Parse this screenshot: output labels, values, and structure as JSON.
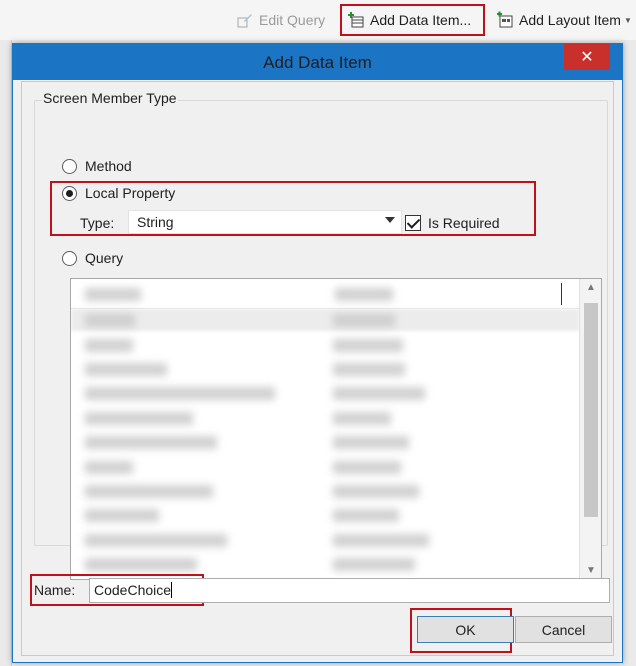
{
  "toolbar": {
    "edit_query": "Edit Query",
    "add_data_item": "Add Data Item...",
    "add_layout_item": "Add Layout Item"
  },
  "dialog": {
    "title": "Add Data Item",
    "close_glyph": "✕",
    "group_label": "Screen Member Type",
    "options": {
      "method": "Method",
      "local_property": "Local Property",
      "query": "Query"
    },
    "selected_option": "Local Property",
    "type_label": "Type:",
    "type_value": "String",
    "is_required_label": "Is Required",
    "is_required_checked": true,
    "name_label": "Name:",
    "name_value": "CodeChoice",
    "ok_label": "OK",
    "cancel_label": "Cancel"
  },
  "icons": {
    "edit_query": "edit-query-icon",
    "add_data_item": "add-data-item-icon",
    "add_layout_item": "add-layout-item-icon",
    "dropdown": "chevron-down-icon",
    "close": "close-icon"
  },
  "colors": {
    "title_bar": "#1c74c4",
    "highlight": "#c0101a",
    "close_button": "#c9302c"
  }
}
